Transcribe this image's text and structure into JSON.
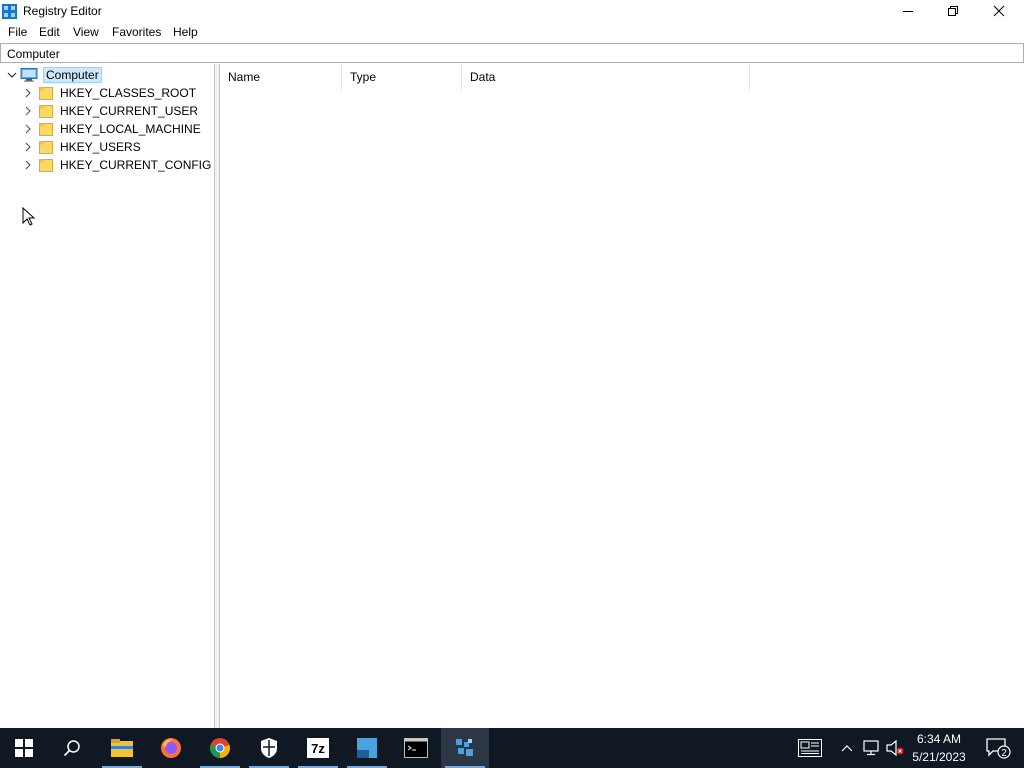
{
  "window": {
    "title": "Registry Editor",
    "minimize_icon": "minimize-icon",
    "maximize_icon": "restore-icon",
    "close_icon": "close-icon"
  },
  "menu": {
    "items": [
      "File",
      "Edit",
      "View",
      "Favorites",
      "Help"
    ]
  },
  "address": {
    "value": "Computer"
  },
  "tree": {
    "root": "Computer",
    "children": [
      "HKEY_CLASSES_ROOT",
      "HKEY_CURRENT_USER",
      "HKEY_LOCAL_MACHINE",
      "HKEY_USERS",
      "HKEY_CURRENT_CONFIG"
    ]
  },
  "list": {
    "columns": [
      "Name",
      "Type",
      "Data"
    ]
  },
  "taskbar": {
    "apps": [
      "start-icon",
      "search-icon",
      "file-explorer-icon",
      "firefox-icon",
      "chrome-icon",
      "windows-security-icon",
      "7zip-icon",
      "app-icon",
      "terminal-icon",
      "registry-editor-icon"
    ]
  },
  "tray": {
    "time": "6:34 AM",
    "date": "5/21/2023",
    "notification_count": "2"
  },
  "colors": {
    "taskbar_bg": "#101823",
    "selection_bg": "#cce8ff",
    "folder_yellow": "#ffd865"
  }
}
